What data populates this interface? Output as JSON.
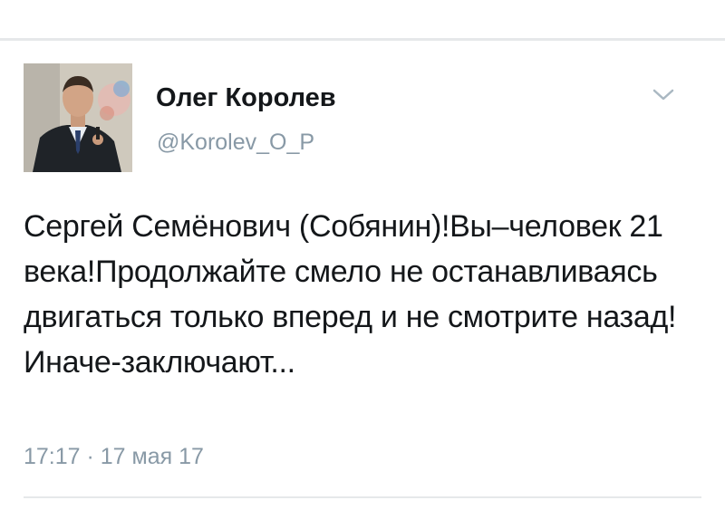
{
  "tweet": {
    "author": {
      "display_name": "Олег Королев",
      "handle": "@Korolev_O_P"
    },
    "text": "Сергей Семёнович (Собянин)!Вы–человек 21 века!Продолжайте смело не останавливаясь двигаться только вперед и не смотрите назад!Иначе-заключают...",
    "timestamp": "17:17 · 17 мая 17",
    "menu_icon": "chevron-down-icon",
    "avatar_icon": "user-avatar"
  },
  "colors": {
    "text_primary": "#14171a",
    "text_secondary": "#8899a6",
    "divider": "#e6e8ea"
  }
}
